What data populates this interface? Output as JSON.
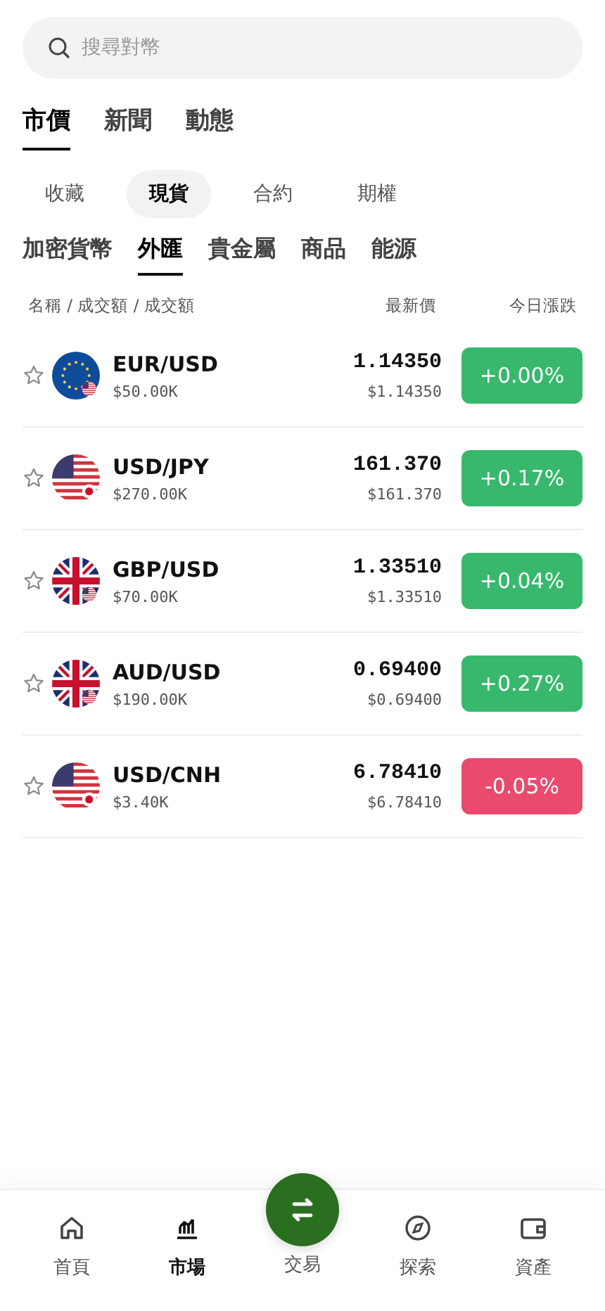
{
  "search": {
    "placeholder": "搜尋對幣"
  },
  "main_tabs": [
    {
      "label": "市價",
      "selected": true
    },
    {
      "label": "新聞",
      "selected": false
    },
    {
      "label": "動態",
      "selected": false
    }
  ],
  "market_types": [
    {
      "label": "收藏",
      "selected": false
    },
    {
      "label": "現貨",
      "selected": true
    },
    {
      "label": "合約",
      "selected": false
    },
    {
      "label": "期權",
      "selected": false
    }
  ],
  "categories": [
    {
      "label": "加密貨幣",
      "selected": false
    },
    {
      "label": "外匯",
      "selected": true
    },
    {
      "label": "貴金屬",
      "selected": false
    },
    {
      "label": "商品",
      "selected": false
    },
    {
      "label": "能源",
      "selected": false
    }
  ],
  "table": {
    "columns": [
      "名稱 / 成交額 / 成交額",
      "最新價",
      "今日漲跌"
    ],
    "rows": [
      {
        "favorite": false,
        "kind": "eu-us",
        "pair": "EUR/USD",
        "volume": "$50.00K",
        "price": "1.14350",
        "price_usd": "$1.14350",
        "change": "+0.00%",
        "color": "#38b86d"
      },
      {
        "favorite": false,
        "kind": "us-jp",
        "pair": "USD/JPY",
        "volume": "$270.00K",
        "price": "161.370",
        "price_usd": "$161.370",
        "change": "+0.17%",
        "color": "#38b86d"
      },
      {
        "favorite": false,
        "kind": "gb-us",
        "pair": "GBP/USD",
        "volume": "$70.00K",
        "price": "1.33510",
        "price_usd": "$1.33510",
        "change": "+0.04%",
        "color": "#38b86d"
      },
      {
        "favorite": false,
        "kind": "gb-us",
        "pair": "AUD/USD",
        "volume": "$190.00K",
        "price": "0.69400",
        "price_usd": "$0.69400",
        "change": "+0.27%",
        "color": "#38b86d"
      },
      {
        "favorite": false,
        "kind": "us-jp",
        "pair": "USD/CNH",
        "volume": "$3.40K",
        "price": "6.78410",
        "price_usd": "$6.78410",
        "change": "-0.05%",
        "color": "#e94a6e"
      }
    ]
  },
  "bottom_nav": [
    {
      "kind": "home",
      "label": "首頁",
      "selected": false
    },
    {
      "kind": "market",
      "label": "市場",
      "selected": true
    },
    {
      "kind": "trade",
      "label": "交易",
      "selected": false
    },
    {
      "kind": "explore",
      "label": "探索",
      "selected": false
    },
    {
      "kind": "wallet",
      "label": "資產",
      "selected": false
    }
  ]
}
